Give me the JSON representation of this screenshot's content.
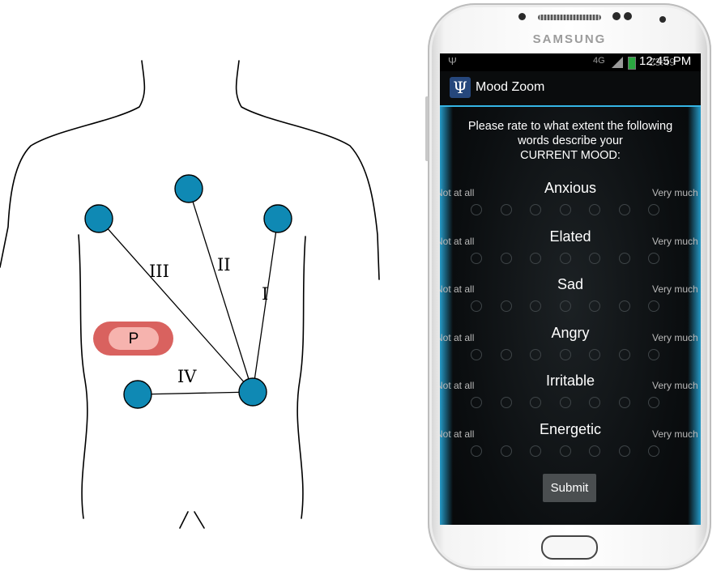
{
  "diagram": {
    "lead_labels": [
      "III",
      "II",
      "I",
      "IV"
    ],
    "patch_label": "P",
    "colors": {
      "electrode": "#0f89b4",
      "patch_outer": "#d9625f",
      "patch_inner": "#f6b3ae",
      "outline": "#000000"
    }
  },
  "phone": {
    "brand": "SAMSUNG",
    "status_bar": {
      "usb_icon": "Ψ",
      "network": "4G",
      "time": "12:45 PM",
      "secondary_time": "23:49"
    },
    "app": {
      "icon": "Ψ",
      "title": "Mood Zoom"
    },
    "prompt_lines": [
      "Please rate to what extent the following",
      "words describe your",
      "CURRENT MOOD:"
    ],
    "scale_left": "Not at all",
    "scale_right": "Very much",
    "radio_count": 7,
    "items": [
      "Anxious",
      "Elated",
      "Sad",
      "Angry",
      "Irritable",
      "Energetic"
    ],
    "submit_label": "Submit",
    "accent_color": "#35b5e5"
  }
}
